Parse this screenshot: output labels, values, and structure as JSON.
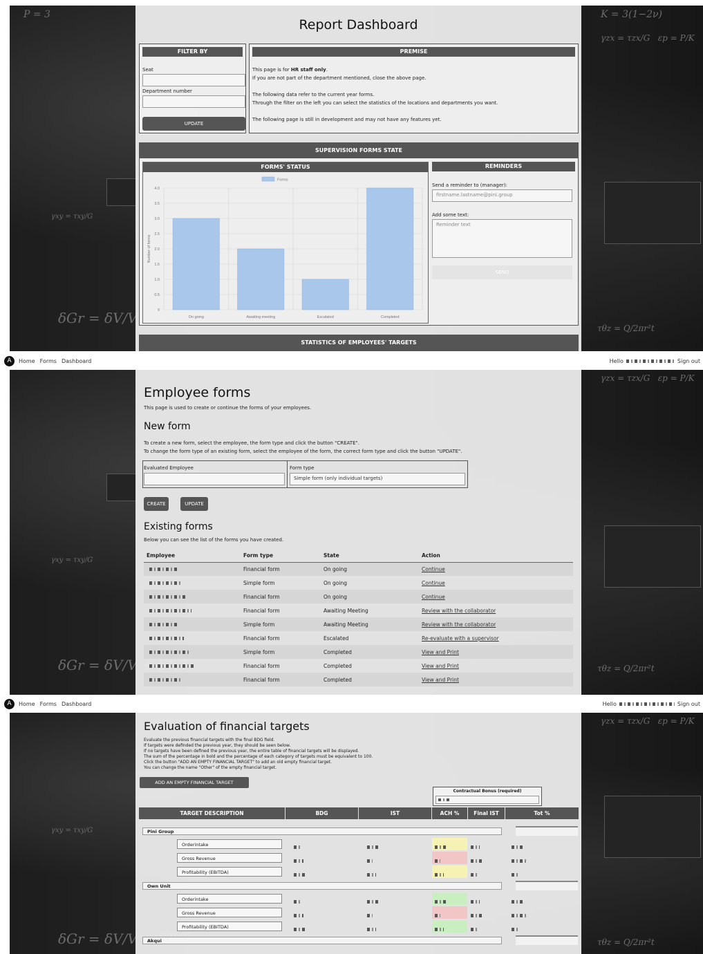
{
  "nav": {
    "logo": "A",
    "items": [
      "Home",
      "Forms",
      "Dashboard"
    ],
    "hello": "Hello",
    "signout": "Sign out"
  },
  "dashboard": {
    "title": "Report Dashboard",
    "filter": {
      "header": "FILTER BY",
      "seat_label": "Seat",
      "dept_label": "Department number",
      "update_button": "UPDATE"
    },
    "premise": {
      "header": "PREMISE",
      "line1_pre": "This page is for ",
      "line1_bold": "HR staff only",
      "line1_post": ".",
      "line2": "If you are not part of the department mentioned, close the above page.",
      "line3": "The following data refer to the current year forms.",
      "line4": "Through the filter on the left you can select the statistics of the locations and departments you want.",
      "line5": "The following page is still in development and may not have any features yet."
    },
    "supervision_header": "SUPERVISION FORMS STATE",
    "status_header": "FORMS' STATUS",
    "reminders": {
      "header": "REMINDERS",
      "send_label": "Send a reminder to (manager):",
      "email_placeholder": "firstname.lastname@pini.group",
      "text_label": "Add some text:",
      "text_placeholder": "Reminder text",
      "send_button": "SEND"
    },
    "statistics_header": "STATISTICS OF EMPLOYEES' TARGETS"
  },
  "chart_data": {
    "type": "bar",
    "categories": [
      "On going",
      "Awaiting meeting",
      "Escalated",
      "Completed"
    ],
    "series": [
      {
        "name": "Forms",
        "values": [
          3,
          2,
          1,
          4
        ]
      }
    ],
    "ylabel": "Number of forms",
    "ylim": [
      0,
      4
    ],
    "yticks": [
      "0",
      "0.5",
      "1.0",
      "1.5",
      "2.0",
      "2.5",
      "3.0",
      "3.5",
      "4.0"
    ],
    "legend": "top-center",
    "grid": true,
    "bar_color": "#a9c7ea"
  },
  "forms": {
    "title": "Employee forms",
    "subtitle": "This page is used to create or continue the forms of your employees.",
    "new_title": "New form",
    "new_line1": "To create a new form, select the employee, the form type and click the button \"CREATE\".",
    "new_line2": "To change the form type of an existing form, select the employee of the form, the correct form type and click the button \"UPDATE\".",
    "eval_label": "Evaluated Employee",
    "type_label": "Form type",
    "type_value": "Simple form (only individual targets)",
    "create_button": "CREATE",
    "update_button": "UPDATE",
    "existing_title": "Existing forms",
    "existing_sub": "Below you can see the list of the forms you have created.",
    "columns": [
      "Employee",
      "Form type",
      "State",
      "Action"
    ],
    "rows": [
      {
        "type": "Financial form",
        "state": "On going",
        "action": "Continue"
      },
      {
        "type": "Simple form",
        "state": "On going",
        "action": "Continue"
      },
      {
        "type": "Financial form",
        "state": "On going",
        "action": "Continue"
      },
      {
        "type": "Financial form",
        "state": "Awaiting Meeting",
        "action": "Review with the collaborator"
      },
      {
        "type": "Simple form",
        "state": "Awaiting Meeting",
        "action": "Review with the collaborator"
      },
      {
        "type": "Financial form",
        "state": "Escalated",
        "action": "Re-evaluate with a supervisor"
      },
      {
        "type": "Simple form",
        "state": "Completed",
        "action": "View and Print"
      },
      {
        "type": "Financial form",
        "state": "Completed",
        "action": "View and Print"
      },
      {
        "type": "Financial form",
        "state": "Completed",
        "action": "View and Print"
      }
    ]
  },
  "financial": {
    "title": "Evaluation of financial targets",
    "lines": [
      "Evaluate the previous financial targets with the final BDG field.",
      "If targets were definded the previous year, they should be seen below.",
      "If no targets have been defined the previous year, the entire table of financial targets will be displayed.",
      "The sum of the percentage in bold and the percentage of each category of targets must be equivalent to 100.",
      "Click the button \"ADD AN EMPTY FINANCIAL TARGET\" to add an old empty financial target.",
      "You can change the name \"Other\" of the empty financial target."
    ],
    "add_button": "ADD AN EMPTY FINANCIAL TARGET",
    "bonus_label": "Contractual Bonus (required)",
    "columns": [
      "TARGET DESCRIPTION",
      "BDG",
      "IST",
      "ACH %",
      "Final IST",
      "Tot %"
    ],
    "groups": [
      {
        "name": "Pini Group",
        "targets": [
          "Orderintake",
          "Gross Revenue",
          "Profitability (EBITDA)"
        ]
      },
      {
        "name": "Own Unit",
        "targets": [
          "Orderintake",
          "Gross Revenue",
          "Profitability (EBITDA)"
        ]
      },
      {
        "name": "Akqui",
        "targets": []
      }
    ],
    "ach_colors": [
      "#f5f2b4",
      "#f2c6c6",
      "#f5f2b4",
      "#c9efc0",
      "#f2c6c6",
      "#c9efc0"
    ]
  }
}
